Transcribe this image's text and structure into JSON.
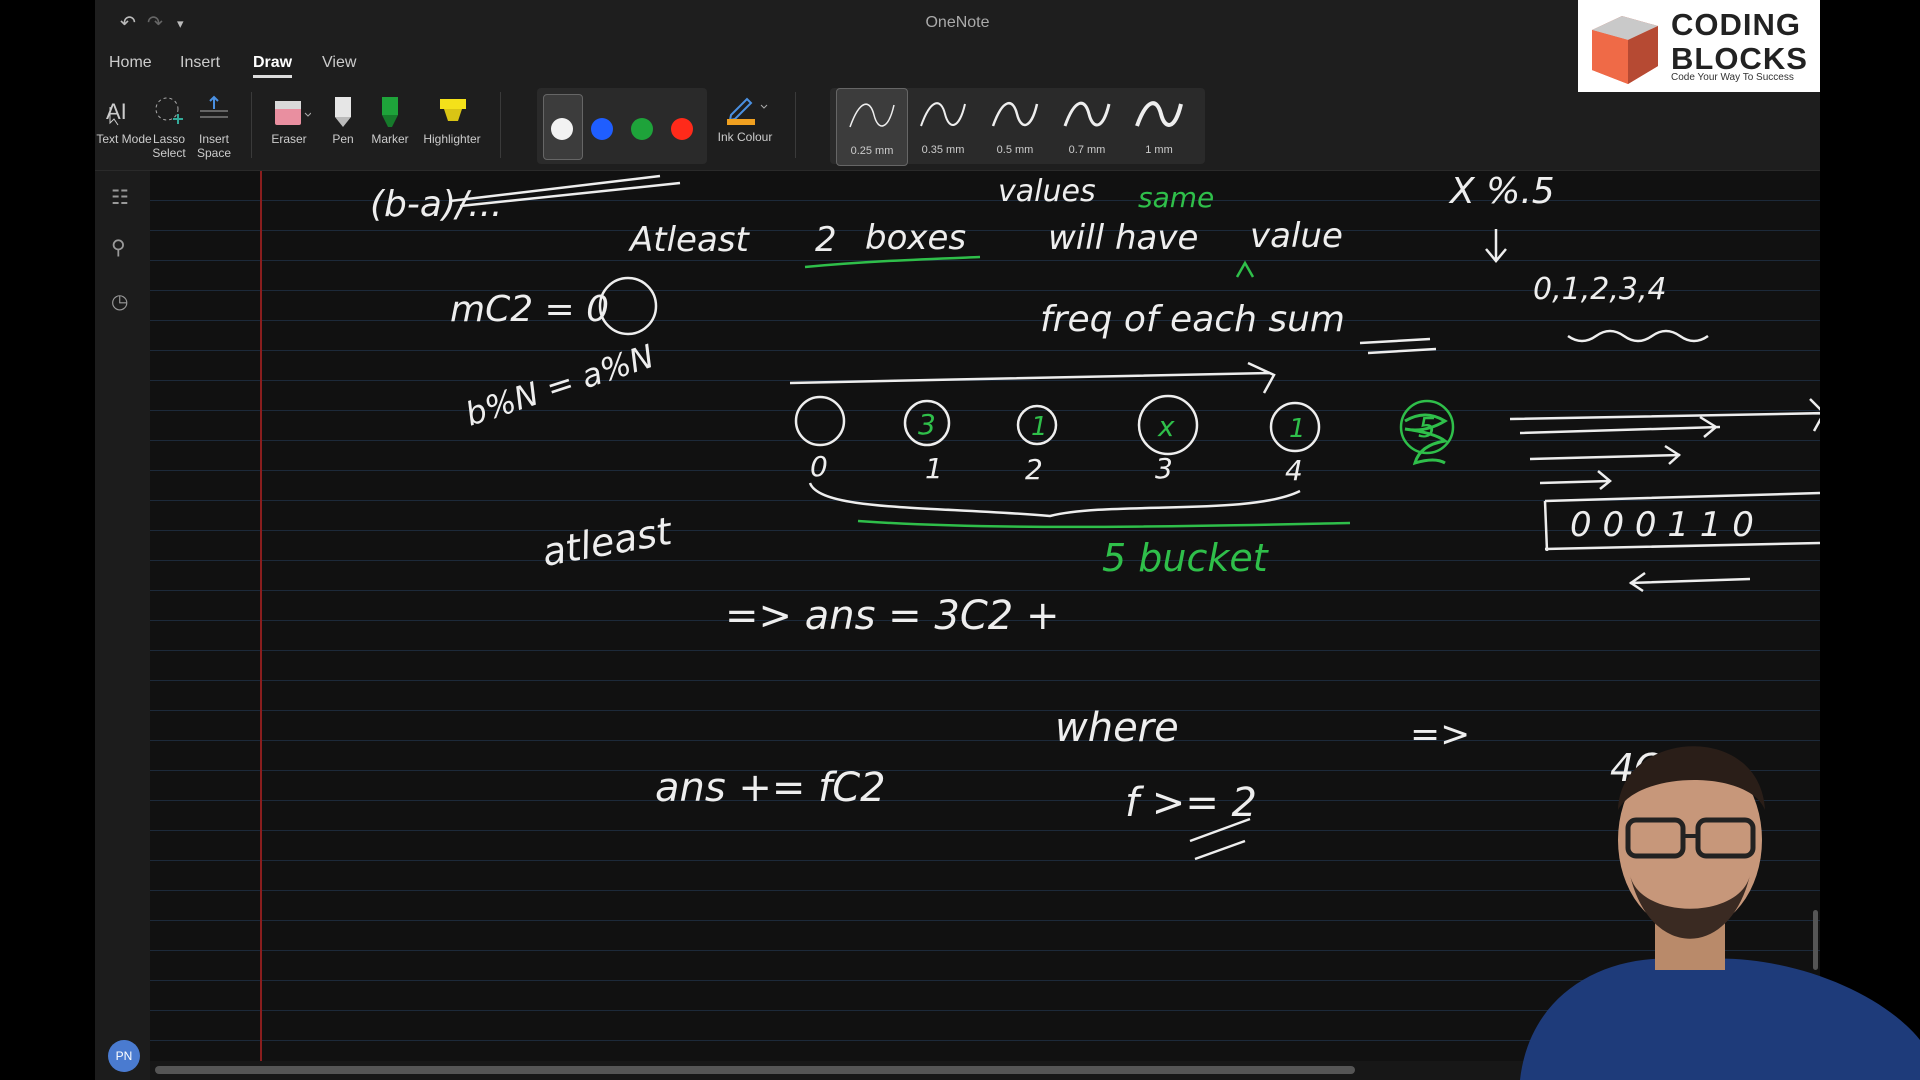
{
  "app": {
    "title": "OneNote"
  },
  "tabs": [
    "Home",
    "Insert",
    "Draw",
    "View"
  ],
  "active_tab": "Draw",
  "tools": [
    {
      "label": "Text Mode",
      "icon": "text-mode-icon"
    },
    {
      "label": "Lasso Select",
      "icon": "lasso-icon"
    },
    {
      "label": "Insert Space",
      "icon": "insert-space-icon"
    },
    {
      "label": "Eraser",
      "icon": "eraser-icon"
    },
    {
      "label": "Pen",
      "icon": "pen-icon"
    },
    {
      "label": "Marker",
      "icon": "marker-icon"
    },
    {
      "label": "Highlighter",
      "icon": "highlighter-icon"
    }
  ],
  "ink_colors": [
    "#f2f2f2",
    "#1f5eff",
    "#1ea33a",
    "#ff2a1a"
  ],
  "selected_color": "#f2f2f2",
  "ink_colour_label": "Ink Colour",
  "thickness": [
    "0.25 mm",
    "0.35 mm",
    "0.5 mm",
    "0.7 mm",
    "1 mm"
  ],
  "selected_thickness": "0.25 mm",
  "avatar": "PN",
  "logo": {
    "line1": "CODING",
    "line2": "BLOCKS",
    "tagline": "Code Your Way To Success"
  },
  "handwriting": {
    "top_left": "(b-a)/...",
    "values": "values",
    "same": "same",
    "x_mod": "X %.5",
    "atleast_line_1": "Atleast",
    "atleast_line_2": "2",
    "atleast_line_3": "boxes",
    "atleast_line_4": "will have",
    "atleast_line_5": "value",
    "mc2": "mC2 = 0",
    "bmod": "b%N = a%N",
    "freq": "freq of each sum",
    "remainders": "0,1,2,3,4",
    "bucket_indices": [
      "0",
      "1",
      "2",
      "3",
      "4"
    ],
    "bucket_contents": [
      "",
      "3",
      "1",
      "x",
      "1",
      "5"
    ],
    "atleast": "atleast",
    "five_bucket": "5 bucket",
    "ans_line": "=> ans = 3C2 +",
    "ans_plus": "ans += fC2",
    "where": "where",
    "f_cond": "f >= 2",
    "implies": "=>",
    "four_c2": "4C2",
    "arr": "0 0 0 1 1 0"
  }
}
